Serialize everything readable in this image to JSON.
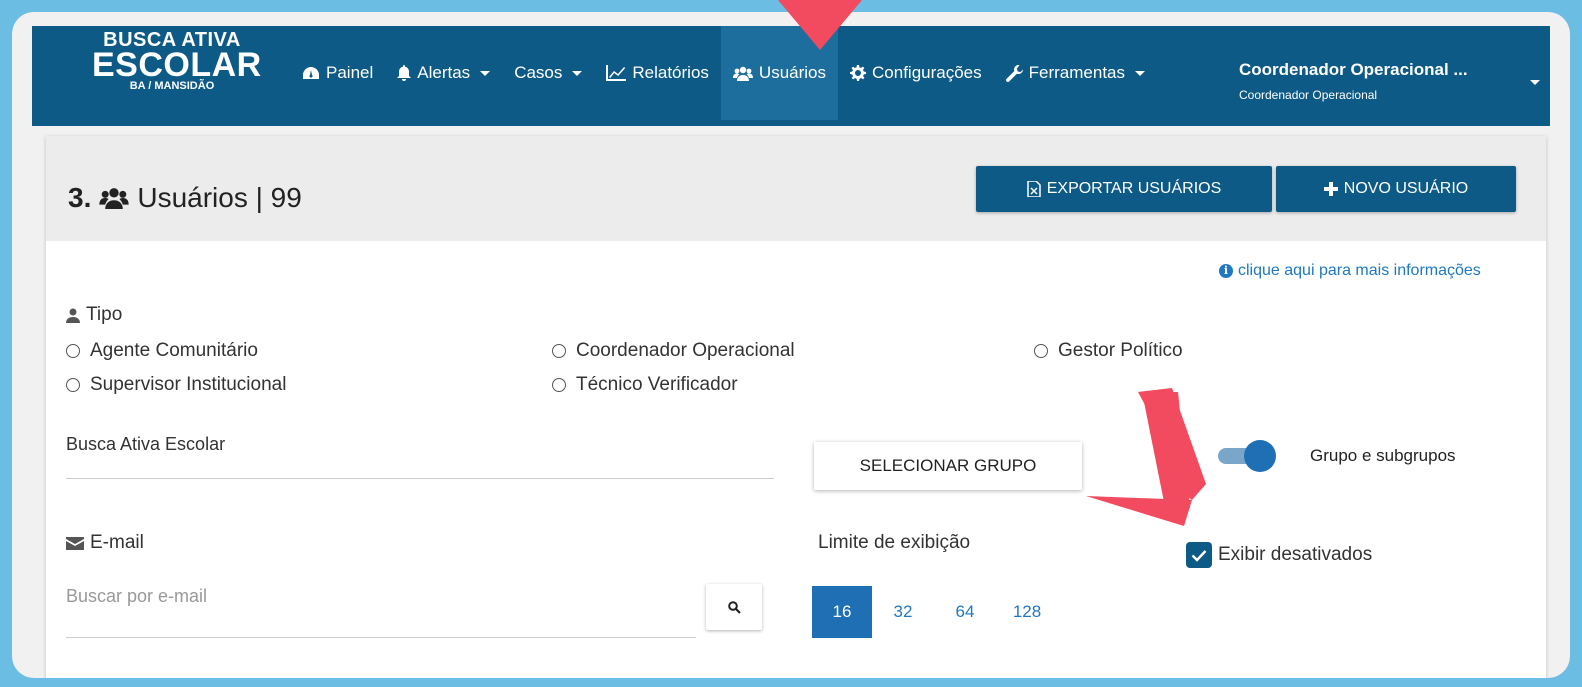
{
  "brand": {
    "line1": "BUSCA ATIVA",
    "line2": "ESCOLAR",
    "line3": "BA / MANSIDÃO"
  },
  "nav": {
    "items": [
      {
        "label": "Painel",
        "icon": "dashboard-icon",
        "dropdown": false
      },
      {
        "label": "Alertas",
        "icon": "bell-icon",
        "dropdown": true
      },
      {
        "label": "Casos",
        "icon": "",
        "dropdown": true
      },
      {
        "label": "Relatórios",
        "icon": "line-chart-icon",
        "dropdown": false
      },
      {
        "label": "Usuários",
        "icon": "users-icon",
        "dropdown": false,
        "active": true
      },
      {
        "label": "Configurações",
        "icon": "gear-icon",
        "dropdown": false
      },
      {
        "label": "Ferramentas",
        "icon": "wrench-icon",
        "dropdown": true
      }
    ],
    "user_name": "Coordenador Operacional ...",
    "user_role": "Coordenador Operacional"
  },
  "page": {
    "title_number": "3.",
    "title_text": "Usuários | 99",
    "export_label": "EXPORTAR USUÁRIOS",
    "new_label": "NOVO USUÁRIO",
    "info_link": "clique aqui para mais informações"
  },
  "filters": {
    "tipo_label": "Tipo",
    "tipo_options": [
      "Agente Comunitário",
      "Coordenador Operacional",
      "Gestor Político",
      "Supervisor Institucional",
      "Técnico Verificador"
    ],
    "group_value": "Busca Ativa Escolar",
    "select_group_label": "SELECIONAR GRUPO",
    "subgroups_label": "Grupo e subgrupos",
    "subgroups_on": true,
    "email_label": "E-mail",
    "email_placeholder": "Buscar por e-mail",
    "limit_label": "Limite de exibição",
    "limit_options": [
      "16",
      "32",
      "64",
      "128"
    ],
    "limit_selected": "16",
    "show_disabled_label": "Exibir desativados",
    "show_disabled_checked": true
  },
  "colors": {
    "navbar": "#0d5a86",
    "accent": "#1f6fb5",
    "link": "#1f78c1",
    "annotation_arrow": "#f24a5e",
    "frame": "#6cbde3"
  }
}
